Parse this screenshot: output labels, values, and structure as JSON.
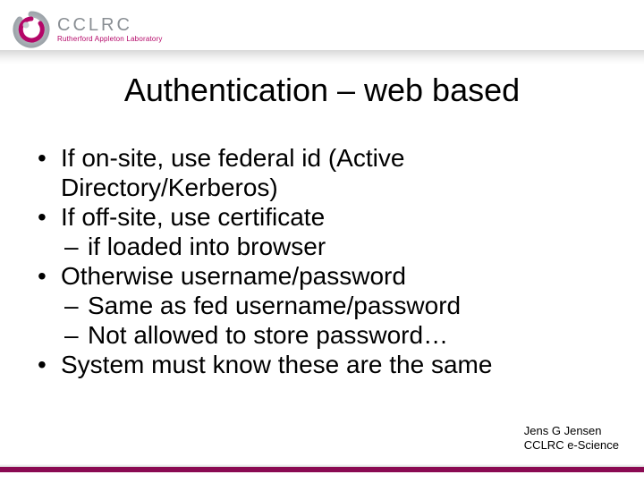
{
  "logo": {
    "main": "CCLRC",
    "sub": "Rutherford Appleton Laboratory"
  },
  "title": "Authentication – web based",
  "bullets": [
    {
      "text": "If on-site, use federal id (Active Directory/Kerberos)",
      "sub": []
    },
    {
      "text": "If off-site, use certificate",
      "sub": [
        "if loaded into browser"
      ]
    },
    {
      "text": "Otherwise username/password",
      "sub": [
        "Same as fed username/password",
        "Not allowed to store password…"
      ]
    },
    {
      "text": "System must know these are the same",
      "sub": []
    }
  ],
  "footer": {
    "line1": "Jens G Jensen",
    "line2": "CCLRC e-Science"
  }
}
